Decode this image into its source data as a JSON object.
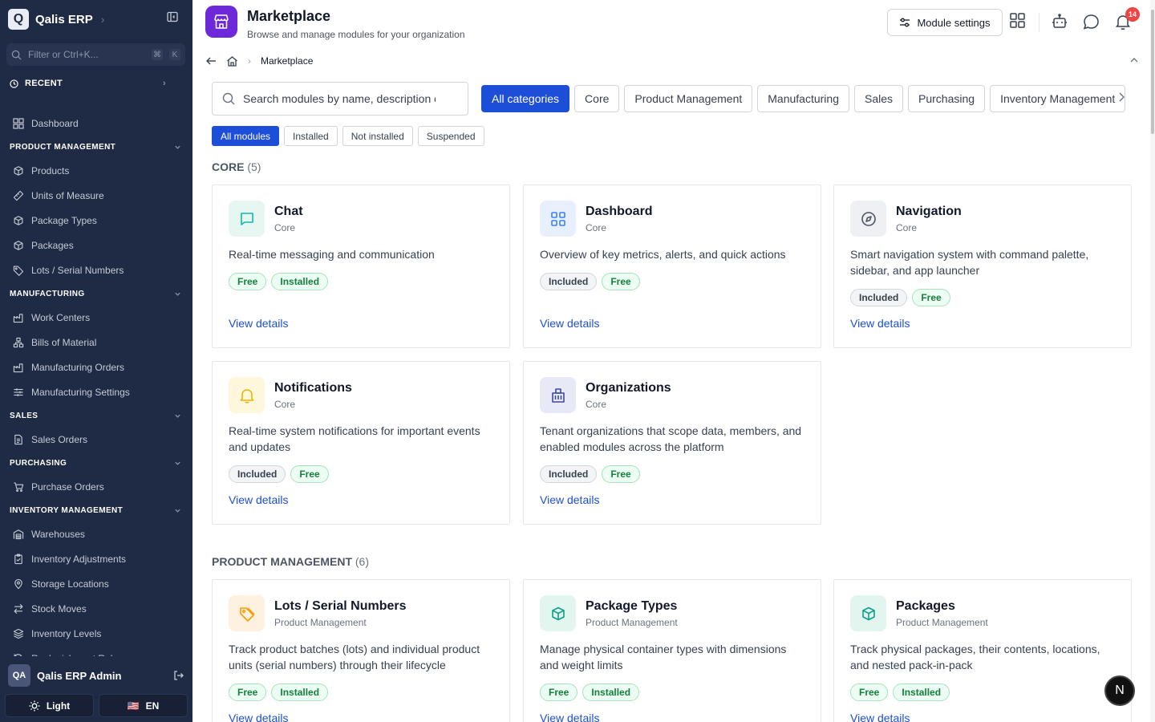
{
  "sidebar": {
    "brand": {
      "logo": "Q",
      "name": "Qalis ERP"
    },
    "filter_placeholder": "Filter or Ctrl+K...",
    "filter_keys": [
      "⌘",
      "K"
    ],
    "recent_label": "RECENT",
    "dashboard_label": "Dashboard",
    "sections": [
      {
        "title": "PRODUCT MANAGEMENT",
        "items": [
          "Products",
          "Units of Measure",
          "Package Types",
          "Packages",
          "Lots / Serial Numbers"
        ]
      },
      {
        "title": "MANUFACTURING",
        "items": [
          "Work Centers",
          "Bills of Material",
          "Manufacturing Orders",
          "Manufacturing Settings"
        ]
      },
      {
        "title": "SALES",
        "items": [
          "Sales Orders"
        ]
      },
      {
        "title": "PURCHASING",
        "items": [
          "Purchase Orders"
        ]
      },
      {
        "title": "INVENTORY MANAGEMENT",
        "items": [
          "Warehouses",
          "Inventory Adjustments",
          "Storage Locations",
          "Stock Moves",
          "Inventory Levels",
          "Replenishment Rules"
        ]
      }
    ],
    "user": {
      "initials": "QA",
      "name": "Qalis ERP Admin"
    },
    "theme_label": "Light",
    "lang": {
      "flag": "🇺🇸",
      "label": "EN"
    }
  },
  "header": {
    "title": "Marketplace",
    "subtitle": "Browse and manage modules for your organization",
    "settings_label": "Module settings",
    "notification_count": "14"
  },
  "breadcrumb": {
    "current": "Marketplace"
  },
  "search": {
    "placeholder": "Search modules by name, description or"
  },
  "categories": [
    "All categories",
    "Core",
    "Product Management",
    "Manufacturing",
    "Sales",
    "Purchasing",
    "Inventory Management"
  ],
  "filters": [
    "All modules",
    "Installed",
    "Not installed",
    "Suspended"
  ],
  "groups": [
    {
      "name": "CORE",
      "count": "(5)",
      "modules": [
        {
          "title": "Chat",
          "category": "Core",
          "description": "Real-time messaging and communication",
          "tags": [
            "Free",
            "Installed"
          ],
          "icon": "chat-icon",
          "link": "View details"
        },
        {
          "title": "Dashboard",
          "category": "Core",
          "description": "Overview of key metrics, alerts, and quick actions",
          "tags": [
            "Included",
            "Free"
          ],
          "icon": "grid-icon",
          "link": "View details"
        },
        {
          "title": "Navigation",
          "category": "Core",
          "description": "Smart navigation system with command palette, sidebar, and app launcher",
          "tags": [
            "Included",
            "Free"
          ],
          "icon": "compass-icon",
          "link": "View details"
        },
        {
          "title": "Notifications",
          "category": "Core",
          "description": "Real-time system notifications for important events and updates",
          "tags": [
            "Included",
            "Free"
          ],
          "icon": "bell-icon",
          "link": "View details"
        },
        {
          "title": "Organizations",
          "category": "Core",
          "description": "Tenant organizations that scope data, members, and enabled modules across the platform",
          "tags": [
            "Included",
            "Free"
          ],
          "icon": "building-icon",
          "link": "View details"
        }
      ]
    },
    {
      "name": "PRODUCT MANAGEMENT",
      "count": "(6)",
      "modules": [
        {
          "title": "Lots / Serial Numbers",
          "category": "Product Management",
          "description": "Track product batches (lots) and individual product units (serial numbers) through their lifecycle",
          "tags": [
            "Free",
            "Installed"
          ],
          "icon": "tag-icon",
          "link": "View details"
        },
        {
          "title": "Package Types",
          "category": "Product Management",
          "description": "Manage physical container types with dimensions and weight limits",
          "tags": [
            "Free",
            "Installed"
          ],
          "icon": "box-icon",
          "link": "View details"
        },
        {
          "title": "Packages",
          "category": "Product Management",
          "description": "Track physical packages, their contents, locations, and nested pack-in-pack",
          "tags": [
            "Free",
            "Installed"
          ],
          "icon": "box-icon",
          "link": "View details"
        }
      ]
    }
  ],
  "dev_badge": "N",
  "colors": {
    "sidebar_bg": "#1f2a44",
    "accent": "#1d4ed8",
    "brand_icon_bg": "#6d28d9",
    "tag_green": "#15803d"
  }
}
